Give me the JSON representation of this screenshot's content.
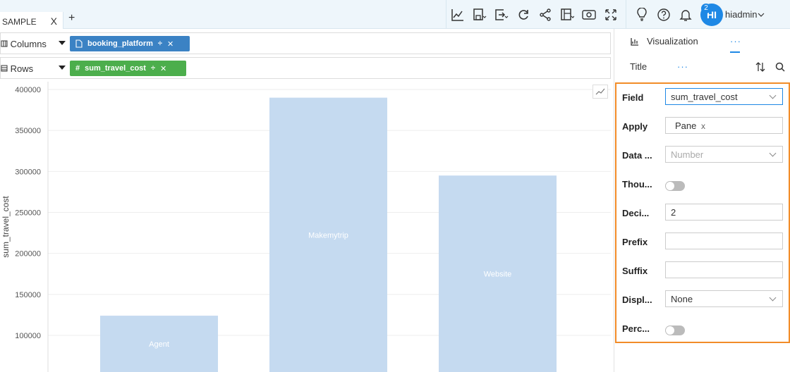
{
  "tabs": [
    {
      "label": "SAMPLE",
      "close": "X"
    }
  ],
  "add_tab": "+",
  "user": {
    "initials": "HI",
    "name": "hiadmin",
    "notifications": "2"
  },
  "toolbar": [
    "chart-line-icon",
    "save-icon",
    "export-icon",
    "refresh-icon",
    "share-icon",
    "layout-icon",
    "preview-icon",
    "fullscreen-icon",
    "bulb-icon",
    "help-icon",
    "bell-icon"
  ],
  "shelves": {
    "columns": {
      "label": "Columns",
      "pill": "booking_platform",
      "pill_color": "#3b82c4"
    },
    "rows": {
      "label": "Rows",
      "pill": "sum_travel_cost",
      "pill_color": "#4cae4c"
    }
  },
  "panel": {
    "tabs": [
      "Visualization",
      "···"
    ],
    "subtabs": [
      "Title",
      "···"
    ],
    "rows": [
      {
        "label": "Field",
        "value": "sum_travel_cost",
        "type": "select"
      },
      {
        "label": "Apply",
        "value": "Pane",
        "type": "chip"
      },
      {
        "label": "Data ...",
        "value": "Number",
        "type": "select-disabled"
      },
      {
        "label": "Thou...",
        "type": "toggle"
      },
      {
        "label": "Deci...",
        "value": "2",
        "type": "input"
      },
      {
        "label": "Prefix",
        "value": "",
        "type": "input"
      },
      {
        "label": "Suffix",
        "value": "",
        "type": "input"
      },
      {
        "label": "Displ...",
        "value": "None",
        "type": "select"
      },
      {
        "label": "Perc...",
        "type": "toggle"
      }
    ]
  },
  "chart_data": {
    "type": "bar",
    "categories": [
      "Agent",
      "Makemytrip",
      "Website"
    ],
    "values": [
      124000,
      390000,
      295000
    ],
    "ylabel": "sum_travel_cost",
    "yticks": [
      "100000",
      "150000",
      "200000",
      "250000",
      "300000",
      "350000",
      "400000"
    ],
    "bar_color": "#c5daf0"
  }
}
